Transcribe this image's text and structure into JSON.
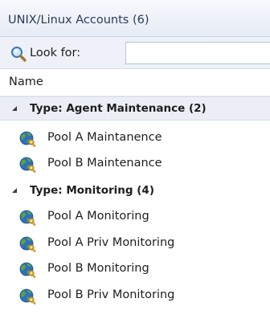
{
  "panel": {
    "title": "UNIX/Linux Accounts (6)"
  },
  "search": {
    "label": "Look for:",
    "value": "",
    "icon": "search-icon"
  },
  "columns": {
    "name": "Name"
  },
  "groups": [
    {
      "label": "Type: Agent Maintenance (2)",
      "expanded": true,
      "items": [
        {
          "label": "Pool A Maintanence",
          "icon": "account-pool-icon"
        },
        {
          "label": "Pool B Maintenance",
          "icon": "account-pool-icon"
        }
      ]
    },
    {
      "label": "Type: Monitoring (4)",
      "expanded": true,
      "items": [
        {
          "label": "Pool A Monitoring",
          "icon": "account-pool-icon"
        },
        {
          "label": "Pool A Priv Monitoring",
          "icon": "account-pool-icon"
        },
        {
          "label": "Pool B Monitoring",
          "icon": "account-pool-icon"
        },
        {
          "label": "Pool B Priv Monitoring",
          "icon": "account-pool-icon"
        }
      ]
    }
  ],
  "colors": {
    "title_text": "#2b3a55",
    "group_shade": "#ebeff5",
    "globe_blue": "#2f6fc0",
    "globe_green": "#5aa63a",
    "key_gold": "#e2b43a"
  }
}
